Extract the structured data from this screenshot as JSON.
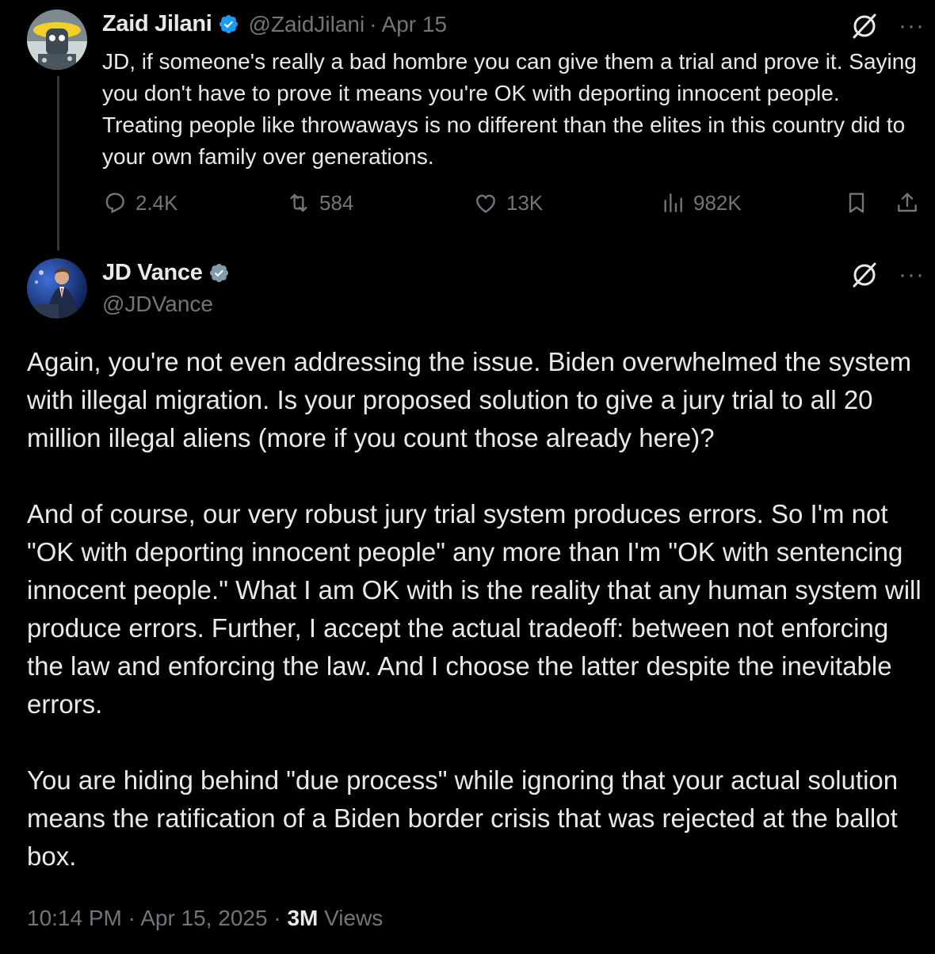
{
  "reply_tweet": {
    "author": {
      "name": "Zaid Jilani",
      "handle": "@ZaidJilani",
      "date": "Apr 15"
    },
    "text": "JD, if someone's really a bad hombre you can give them a trial and prove it. Saying you don't have to prove it means you're OK with deporting innocent people. Treating people like throwaways is no different than the elites in this country did to your own family over generations.",
    "stats": {
      "replies": "2.4K",
      "reposts": "584",
      "likes": "13K",
      "views": "982K"
    },
    "icons": [
      "grok-icon",
      "more-icon",
      "reply-icon",
      "repost-icon",
      "like-icon",
      "views-icon",
      "bookmark-icon",
      "share-icon"
    ]
  },
  "main_tweet": {
    "author": {
      "name": "JD Vance",
      "handle": "@JDVance"
    },
    "paragraphs": [
      "Again, you're not even addressing the issue. Biden overwhelmed the system with illegal migration. Is your proposed solution to give a jury trial to all 20 million illegal aliens (more if you count those already here)?",
      "And of course, our very robust jury trial system produces errors. So I'm not \"OK with deporting innocent people\" any more than I'm \"OK with sentencing innocent people.\" What I am OK with is the reality that any human system will produce errors. Further, I accept the actual tradeoff: between not enforcing the law and enforcing the law. And I choose the latter despite the inevitable errors.",
      "You are hiding behind \"due process\" while ignoring that your actual solution means the ratification of a Biden border crisis that was rejected at the ballot box."
    ],
    "footer": {
      "time": "10:14 PM",
      "date": "Apr 15, 2025",
      "views_count": "3M",
      "views_label": "Views"
    }
  },
  "colors": {
    "background": "#000000",
    "text_primary": "#e7e9ea",
    "text_secondary": "#71767b",
    "verified_blue": "#1d9bf0",
    "verified_gray": "#829aab",
    "thread_line": "#333639"
  }
}
